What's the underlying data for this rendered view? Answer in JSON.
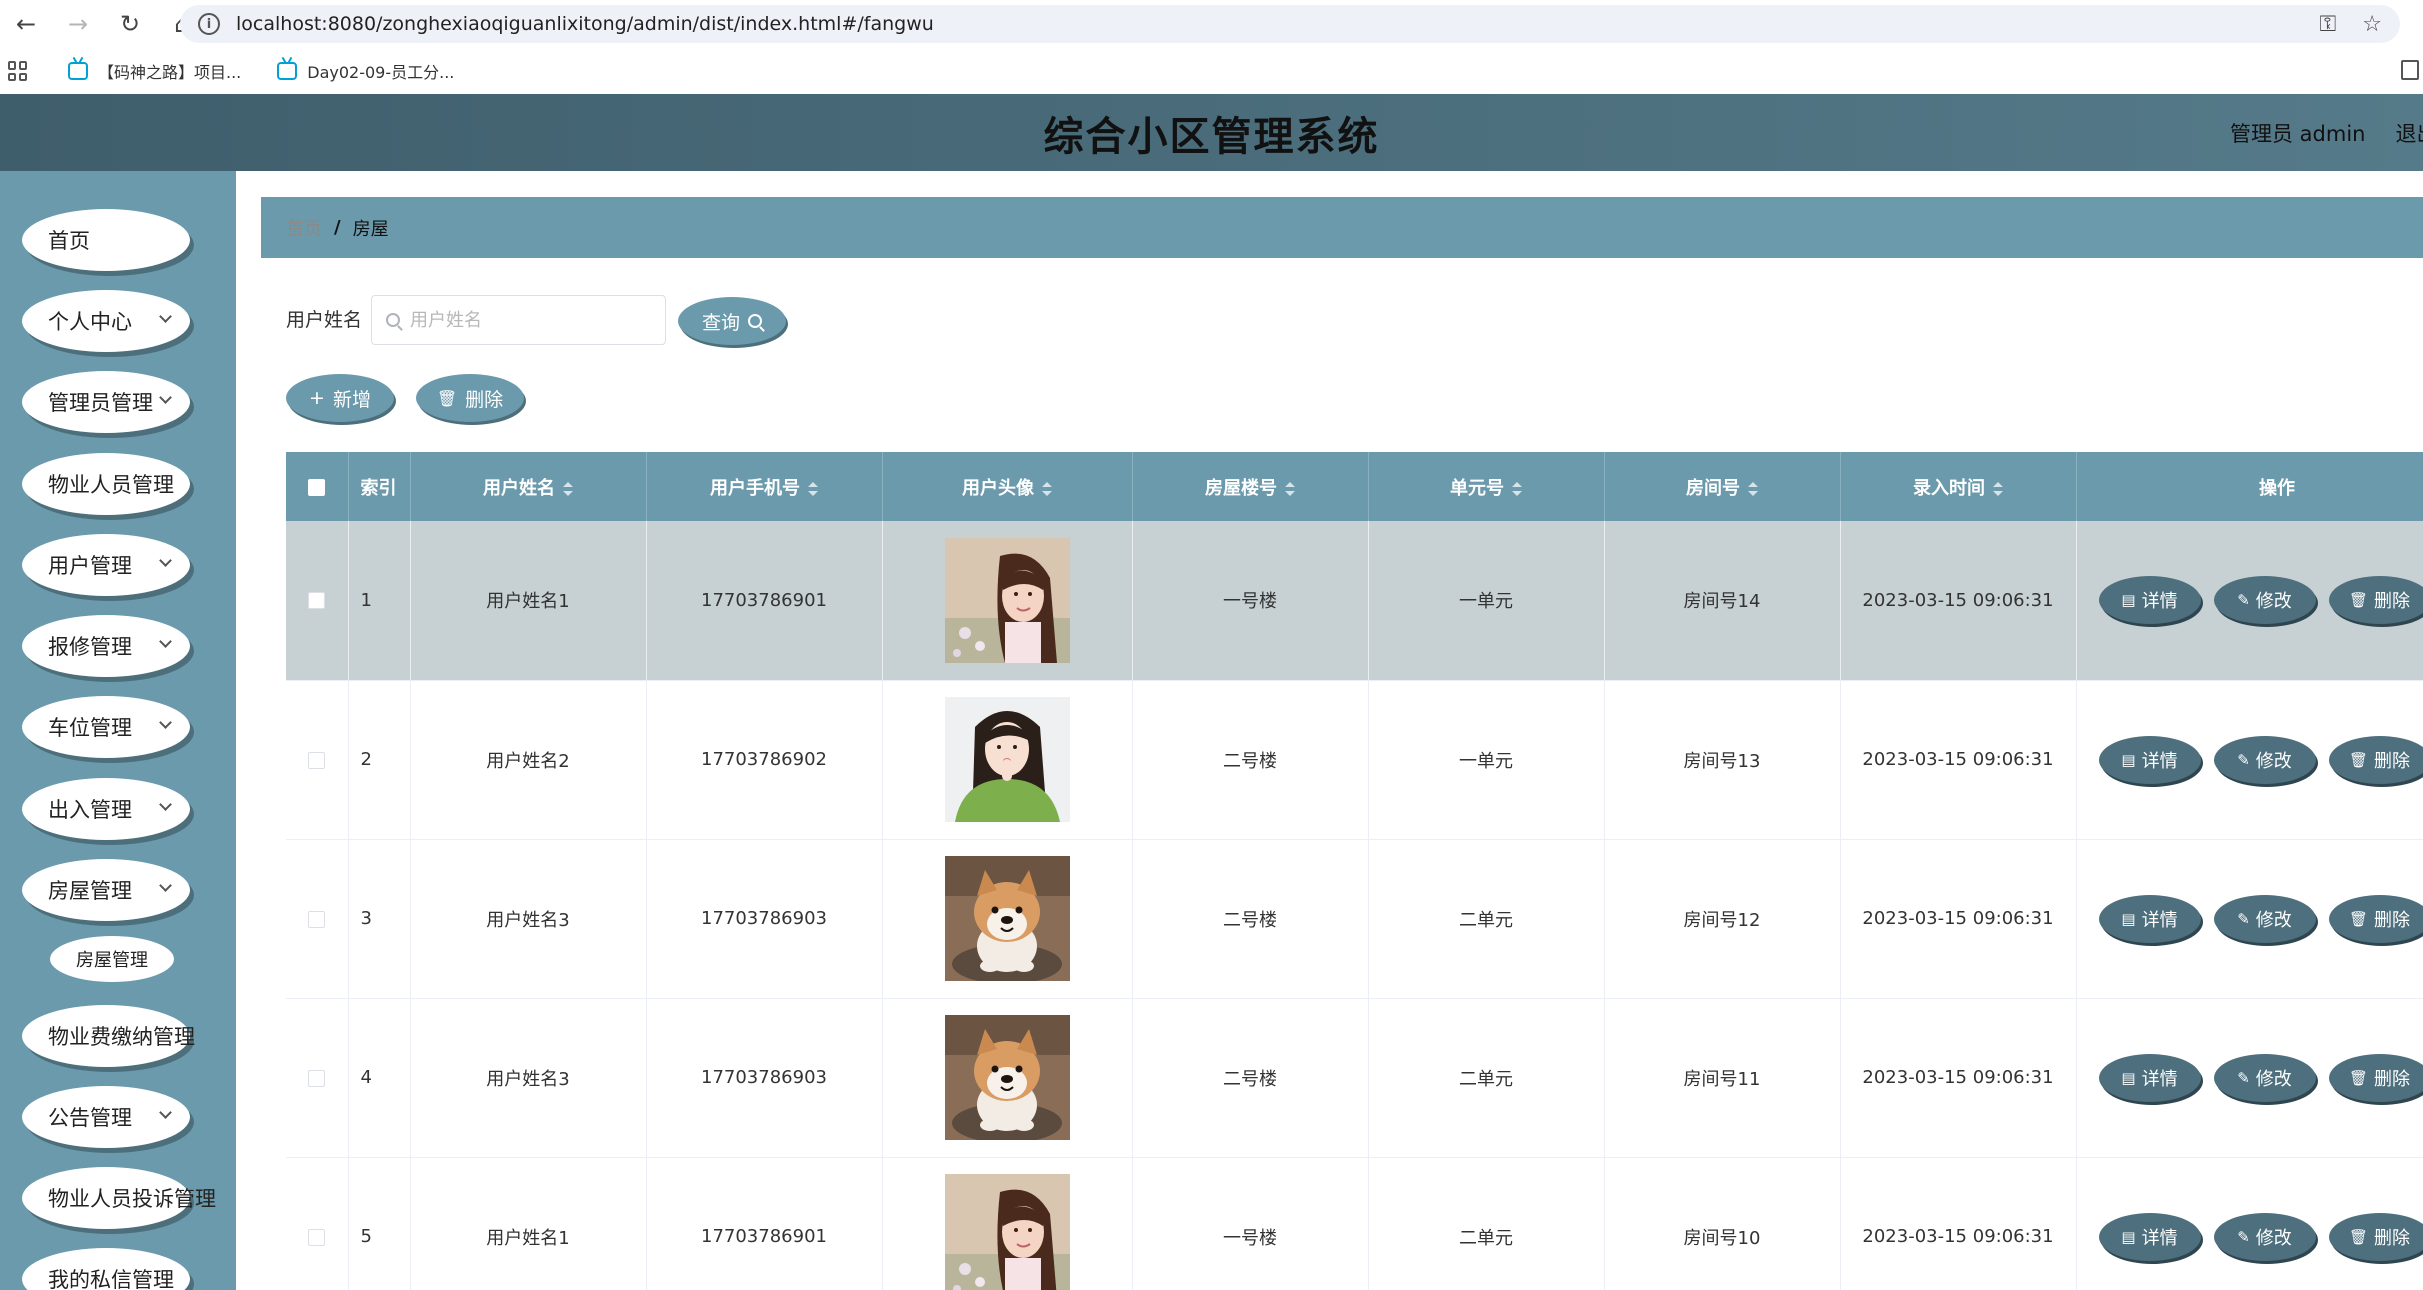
{
  "browser": {
    "url": "localhost:8080/zonghexiaoqiguanlixitong/admin/dist/index.html#/fangwu",
    "bookmarks": [
      "【码神之路】项目...",
      "Day02-09-员工分..."
    ]
  },
  "header": {
    "title": "综合小区管理系统",
    "user": "管理员 admin",
    "logout": "退出"
  },
  "sidebar": {
    "items": [
      {
        "label": "首页",
        "chevron": false
      },
      {
        "label": "个人中心",
        "chevron": true
      },
      {
        "label": "管理员管理",
        "chevron": true
      },
      {
        "label": "物业人员管理",
        "chevron": false
      },
      {
        "label": "用户管理",
        "chevron": true
      },
      {
        "label": "报修管理",
        "chevron": true
      },
      {
        "label": "车位管理",
        "chevron": true
      },
      {
        "label": "出入管理",
        "chevron": true
      },
      {
        "label": "房屋管理",
        "chevron": true
      },
      {
        "label": "物业费缴纳管理",
        "chevron": false
      },
      {
        "label": "公告管理",
        "chevron": true
      },
      {
        "label": "物业人员投诉管理",
        "chevron": false
      },
      {
        "label": "我的私信管理",
        "chevron": false
      }
    ],
    "sub_item": "房屋管理"
  },
  "breadcrumb": {
    "home": "首页",
    "separator": "/",
    "current": "房屋"
  },
  "search": {
    "label": "用户姓名",
    "placeholder": "用户姓名",
    "button": "查询"
  },
  "actions": {
    "add": "新增",
    "delete": "删除"
  },
  "table": {
    "columns": [
      "索引",
      "用户姓名",
      "用户手机号",
      "用户头像",
      "房屋楼号",
      "单元号",
      "房间号",
      "录入时间",
      "操作"
    ],
    "rows": [
      {
        "index": "1",
        "name": "用户姓名1",
        "phone": "17703786901",
        "avatar": "girl-photo",
        "building": "一号楼",
        "unit": "一单元",
        "room": "房间号14",
        "time": "2023-03-15 09:06:31"
      },
      {
        "index": "2",
        "name": "用户姓名2",
        "phone": "17703786902",
        "avatar": "girl-green-photo",
        "building": "二号楼",
        "unit": "一单元",
        "room": "房间号13",
        "time": "2023-03-15 09:06:31"
      },
      {
        "index": "3",
        "name": "用户姓名3",
        "phone": "17703786903",
        "avatar": "dog-photo",
        "building": "二号楼",
        "unit": "二单元",
        "room": "房间号12",
        "time": "2023-03-15 09:06:31"
      },
      {
        "index": "4",
        "name": "用户姓名3",
        "phone": "17703786903",
        "avatar": "dog-photo",
        "building": "二号楼",
        "unit": "二单元",
        "room": "房间号11",
        "time": "2023-03-15 09:06:31"
      },
      {
        "index": "5",
        "name": "用户姓名1",
        "phone": "17703786901",
        "avatar": "girl-photo",
        "building": "一号楼",
        "unit": "二单元",
        "room": "房间号10",
        "time": "2023-03-15 09:06:31"
      }
    ],
    "row_actions": {
      "detail": "详情",
      "edit": "修改",
      "delete": "删除"
    }
  },
  "colors": {
    "header": "#557a89",
    "sidebar": "#6b9aac",
    "button_dark": "#4e6f7d",
    "highlight_row": "#c7d1d4"
  }
}
